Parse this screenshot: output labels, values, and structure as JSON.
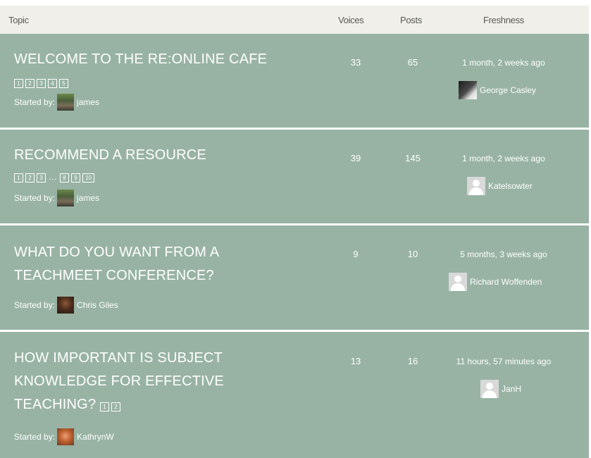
{
  "header": {
    "topic": "Topic",
    "voices": "Voices",
    "posts": "Posts",
    "freshness": "Freshness"
  },
  "started_by_label": "Started by:",
  "topics": [
    {
      "title": "WELCOME TO THE RE:ONLINE CAFE",
      "pages": [
        "1",
        "2",
        "3",
        "4",
        "5"
      ],
      "author": "james",
      "voices": "33",
      "posts": "65",
      "freshness": "1 month, 2 weeks ago",
      "last_poster": "George Casley"
    },
    {
      "title": "RECOMMEND A RESOURCE",
      "pages": [
        "1",
        "2",
        "3",
        "…",
        "8",
        "9",
        "10"
      ],
      "author": "james",
      "voices": "39",
      "posts": "145",
      "freshness": "1 month, 2 weeks ago",
      "last_poster": "Katelsowter"
    },
    {
      "title_line1": "WHAT DO YOU WANT FROM A",
      "title_line2": "TEACHMEET CONFERENCE?",
      "author": "Chris Giles",
      "voices": "9",
      "posts": "10",
      "freshness": "5 months, 3 weeks ago",
      "last_poster": "Richard Woffenden"
    },
    {
      "title_line1": "HOW IMPORTANT IS SUBJECT",
      "title_line2": "KNOWLEDGE FOR EFFECTIVE",
      "title_line3": "TEACHING?",
      "pages": [
        "1",
        "2"
      ],
      "author": "KathrynW",
      "voices": "13",
      "posts": "16",
      "freshness": "11 hours, 57 minutes ago",
      "last_poster": "JanH"
    }
  ],
  "colors": {
    "row_bg": "#98b3a4",
    "header_bg": "#f1efea",
    "text": "#ffffff"
  }
}
